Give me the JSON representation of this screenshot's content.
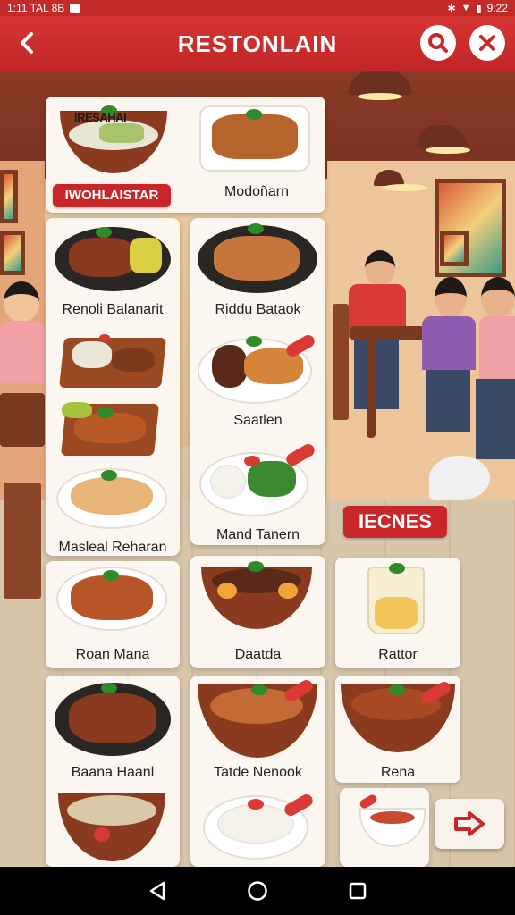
{
  "status_bar": {
    "time": "9:22",
    "left_text": "1:11 TAL 8B"
  },
  "app_bar": {
    "title": "RESTONLAIN"
  },
  "featured": {
    "banner_label": "IWOHLAISTAR",
    "bowl_text": "IRESAHAI",
    "right_label": "Modoñarn"
  },
  "menu_items": [
    {
      "label": "Renoli Balanarit"
    },
    {
      "label": "Riddu Bataok"
    },
    {
      "label": "Saatlen"
    },
    {
      "label": "Masleal Reharan"
    },
    {
      "label": "Mand Tanern"
    },
    {
      "label": "Roan Mana"
    },
    {
      "label": "Daatda"
    },
    {
      "label": "Rattor"
    },
    {
      "label": "Baana Haanl"
    },
    {
      "label": "Tatde Nenook"
    },
    {
      "label": "Rena"
    }
  ],
  "side_tag": {
    "label": "IECNES"
  },
  "icons": {
    "back": "back-arrow-icon",
    "search": "search-icon",
    "close": "close-icon",
    "next": "next-arrow-icon"
  },
  "colors": {
    "brand_red": "#c9262a",
    "card_bg": "#fbf7f0"
  }
}
